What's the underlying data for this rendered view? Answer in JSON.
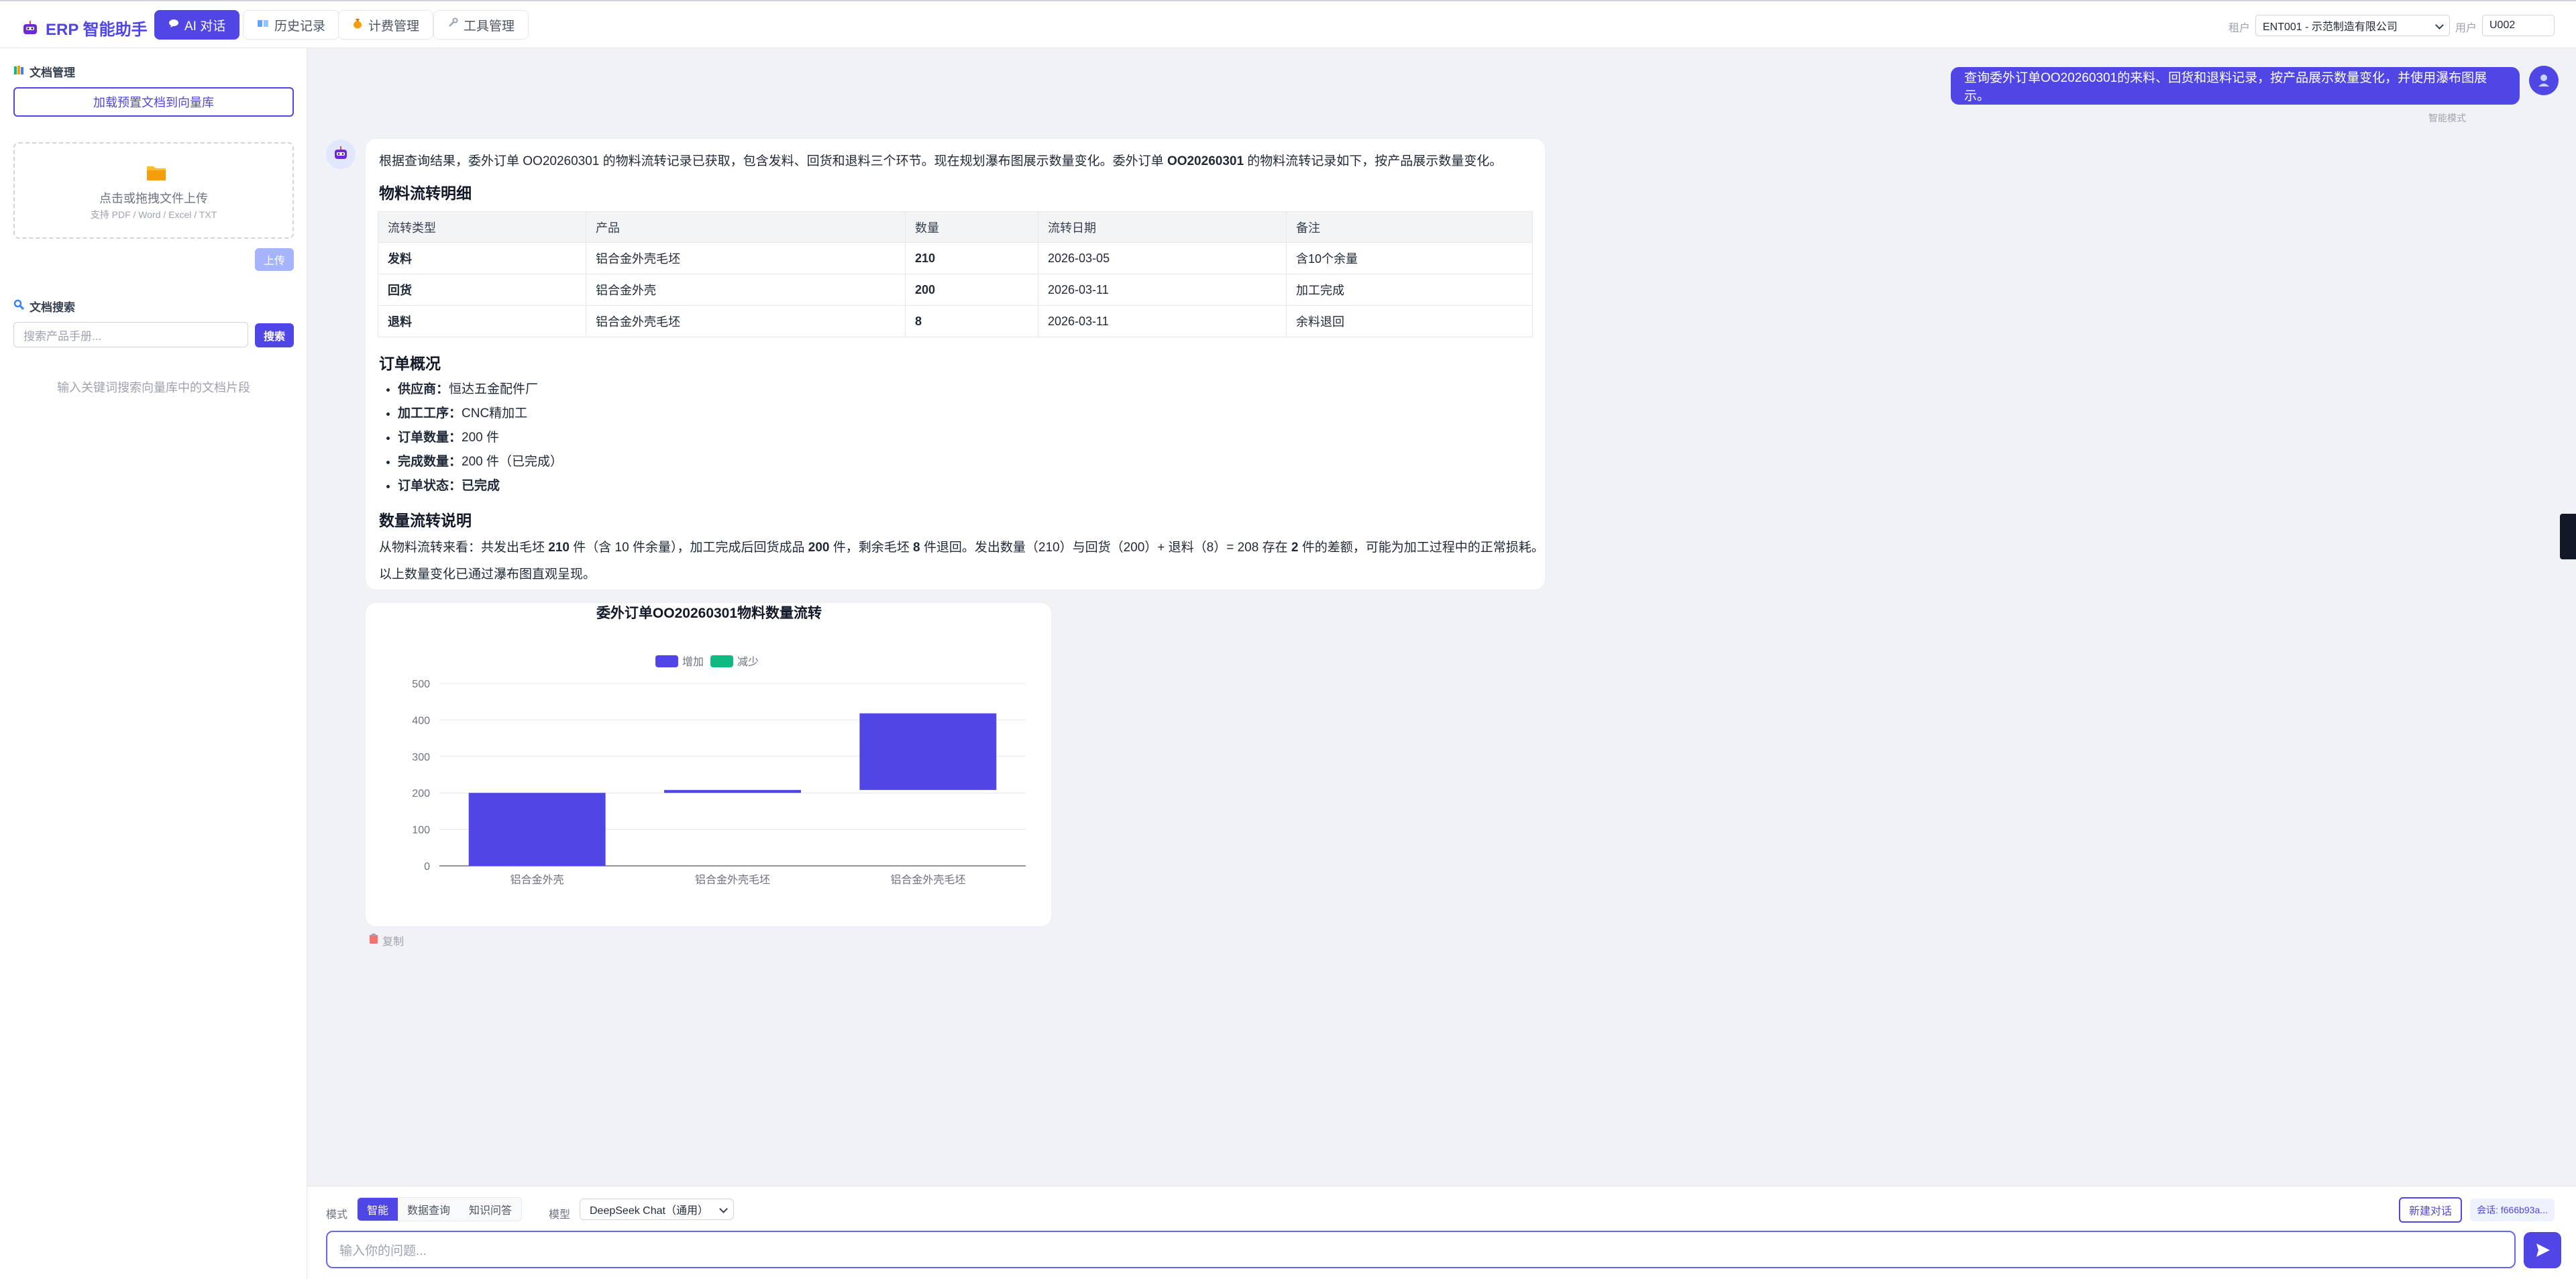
{
  "app": {
    "title": "ERP 智能助手",
    "nav": [
      {
        "label": "AI 对话",
        "icon": "chat-bubble-icon",
        "active": true
      },
      {
        "label": "历史记录",
        "icon": "book-icon",
        "active": false
      },
      {
        "label": "计费管理",
        "icon": "money-bag-icon",
        "active": false
      },
      {
        "label": "工具管理",
        "icon": "wrench-icon",
        "active": false
      }
    ],
    "tenant_label": "租户",
    "tenant_value": "ENT001 - 示范制造有限公司",
    "user_label": "用户",
    "user_value": "U002"
  },
  "sidebar": {
    "docs_title": "文档管理",
    "load_preset": "加载预置文档到向量库",
    "dropzone_text": "点击或拖拽文件上传",
    "dropzone_sub": "支持 PDF / Word / Excel / TXT",
    "upload": "上传",
    "search_title": "文档搜索",
    "search_placeholder": "搜索产品手册...",
    "search_button": "搜索",
    "search_hint": "输入关键词搜索向量库中的文档片段"
  },
  "chat": {
    "user_message": "查询委外订单OO20260301的来料、回货和退料记录，按产品展示数量变化，并使用瀑布图展示。",
    "mode_caption": "智能模式",
    "intro_text": "根据查询结果，委外订单 OO20260301 的物料流转记录已获取，包含发料、回货和退料三个环节。现在规划瀑布图展示数量变化。委外订单 ",
    "intro_bold": "OO20260301",
    "intro_tail": " 的物料流转记录如下，按产品展示数量变化。",
    "table_title": "物料流转明细",
    "table_headers": [
      "流转类型",
      "产品",
      "数量",
      "流转日期",
      "备注"
    ],
    "table_rows": [
      [
        "发料",
        "铝合金外壳毛坯",
        "210",
        "2026-03-05",
        "含10个余量"
      ],
      [
        "回货",
        "铝合金外壳",
        "200",
        "2026-03-11",
        "加工完成"
      ],
      [
        "退料",
        "铝合金外壳毛坯",
        "8",
        "2026-03-11",
        "余料退回"
      ]
    ],
    "summary_title": "订单概况",
    "summary": [
      {
        "k": "供应商：",
        "v": "恒达五金配件厂"
      },
      {
        "k": "加工工序：",
        "v": "CNC精加工"
      },
      {
        "k": "订单数量：",
        "v": "200 件"
      },
      {
        "k": "完成数量：",
        "v": "200 件（已完成）"
      },
      {
        "k": "订单状态：",
        "v": "已完成",
        "vbold": true
      }
    ],
    "explain_title": "数量流转说明",
    "explain_p1_a": "从物料流转来看：共发出毛坯 ",
    "explain_p1_b": "210",
    "explain_p1_c": " 件（含 10 件余量），加工完成后回货成品 ",
    "explain_p1_d": "200",
    "explain_p1_e": " 件，剩余毛坯 ",
    "explain_p1_f": "8",
    "explain_p1_g": " 件退回。发出数量（210）与回货（200）+ 退料（8）= 208 存在 ",
    "explain_p1_h": "2",
    "explain_p1_i": " 件的差额，可能为加工过程中的正常损耗。",
    "explain_p2": "以上数量变化已通过瀑布图直观呈现。",
    "copy_label": "复制"
  },
  "chart_data": {
    "type": "bar",
    "title": "委外订单OO20260301物料数量流转",
    "legend": [
      "增加",
      "减少"
    ],
    "legend_colors": [
      "#4f46e5",
      "#10b981"
    ],
    "legend_position": "top",
    "categories": [
      "铝合金外壳",
      "铝合金外壳毛坯",
      "铝合金外壳毛坯"
    ],
    "bars": [
      {
        "base": 0,
        "value": 200,
        "series": "增加"
      },
      {
        "base": 200,
        "value": 8,
        "series": "增加"
      },
      {
        "base": 208,
        "value": 210,
        "series": "增加"
      }
    ],
    "ylim": [
      0,
      500
    ],
    "yticks": [
      0,
      100,
      200,
      300,
      400,
      500
    ],
    "grid": true
  },
  "bottom": {
    "mode_label": "模式",
    "modes": [
      "智能",
      "数据查询",
      "知识问答"
    ],
    "active_mode": 0,
    "model_label": "模型",
    "model_value": "DeepSeek Chat（通用）",
    "new_chat": "新建对话",
    "session": "会话: f666b93a...",
    "input_placeholder": "输入你的问题..."
  },
  "colors": {
    "accent": "#4f46e5",
    "decrease": "#10b981"
  }
}
